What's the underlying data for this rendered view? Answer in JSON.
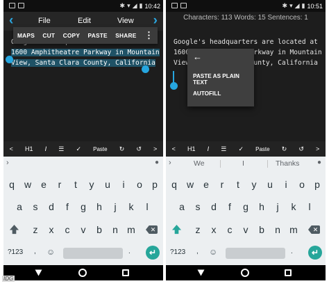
{
  "colors": {
    "accent": "#26a6df",
    "enter_key": "#26a69a",
    "selection": "#1f5266",
    "dark_bg": "#1d1d1d",
    "keyboard_bg": "#eceff1"
  },
  "left": {
    "status": {
      "time": "10:42"
    },
    "header": {
      "file": "File",
      "edit": "Edit",
      "view": "View",
      "back_icon": "chevron-left-icon"
    },
    "context_bar": {
      "maps": "MAPS",
      "cut": "CUT",
      "copy": "COPY",
      "paste": "PASTE",
      "share": "SHARE",
      "more_icon": "overflow-menu-icon"
    },
    "doc": {
      "line1": "Google's headquarters are located at",
      "line2": "1600 Amphitheatre Parkway in Mountain",
      "line3": "View, Santa Clara County, California"
    },
    "toolbar": {
      "left": "<",
      "h1": "H1",
      "italic": "I",
      "list": "☰",
      "check": "✓",
      "paste": "Paste",
      "redo": "↻",
      "undo": "↺",
      "right": ">"
    },
    "keyboard": {
      "row1": [
        "q",
        "w",
        "e",
        "r",
        "t",
        "y",
        "u",
        "i",
        "o",
        "p"
      ],
      "row2": [
        "a",
        "s",
        "d",
        "f",
        "g",
        "h",
        "j",
        "k",
        "l"
      ],
      "row3": [
        "z",
        "x",
        "c",
        "v",
        "b",
        "n",
        "m"
      ],
      "k123": "?123",
      "comma": ",",
      "period": ".",
      "enter": "↵"
    }
  },
  "right": {
    "status": {
      "time": "10:51"
    },
    "stats": "Characters: 113 Words: 15 Sentences: 1",
    "doc": {
      "line1": "Google's headquarters are located at",
      "line2": "1600 Amphitheatre Parkway in Mountain",
      "line3": "View, Santa Clara County, California"
    },
    "popup": {
      "back": "←",
      "paste_plain": "PASTE AS PLAIN TEXT",
      "autofill": "AUTOFILL"
    },
    "toolbar": {
      "left": "<",
      "h1": "H1",
      "italic": "I",
      "list": "☰",
      "check": "✓",
      "paste": "Paste",
      "redo": "↻",
      "undo": "↺",
      "right": ">"
    },
    "suggestions": [
      "We",
      "I",
      "Thanks"
    ],
    "keyboard": {
      "row1": [
        "q",
        "w",
        "e",
        "r",
        "t",
        "y",
        "u",
        "i",
        "o",
        "p"
      ],
      "row2": [
        "a",
        "s",
        "d",
        "f",
        "g",
        "h",
        "j",
        "k",
        "l"
      ],
      "row3": [
        "z",
        "x",
        "c",
        "v",
        "b",
        "n",
        "m"
      ],
      "k123": "?123",
      "comma": ",",
      "period": ".",
      "enter": "↵"
    }
  },
  "watermark": "IDG"
}
